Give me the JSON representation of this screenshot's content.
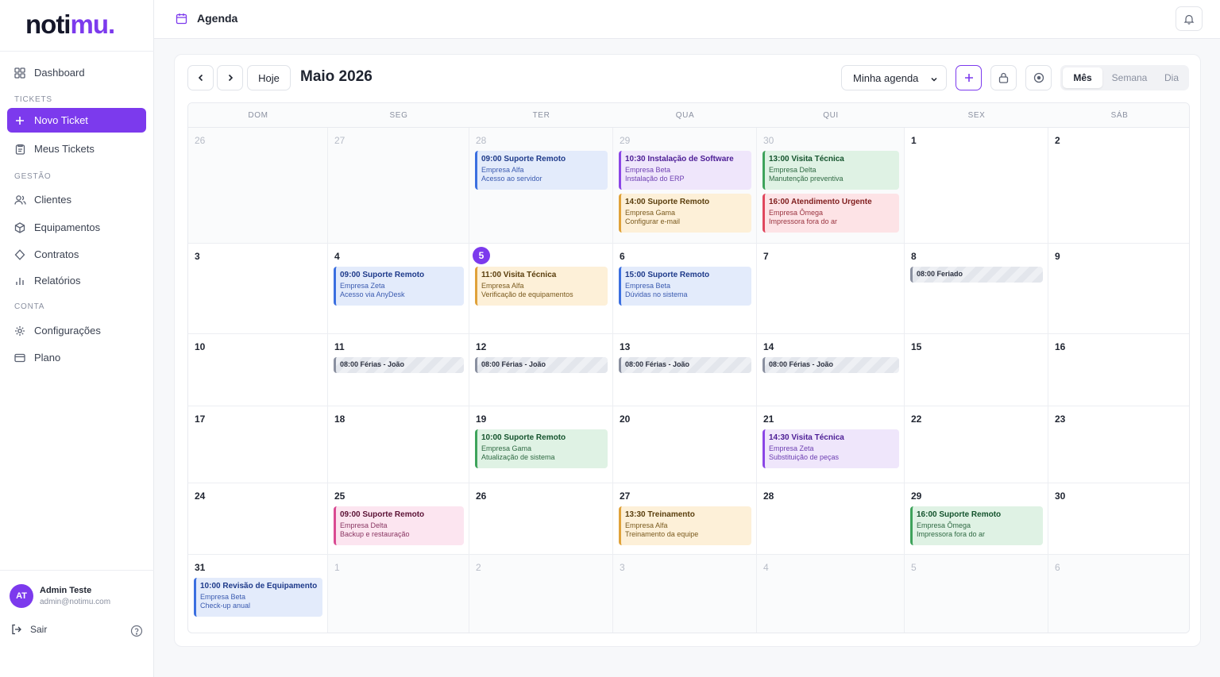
{
  "app": {
    "logo_main": "noti",
    "logo_accent": "mu",
    "logo_dot": "."
  },
  "sidebar": {
    "dashboard": "Dashboard",
    "section_tickets": "TICKETS",
    "new_ticket": "Novo Ticket",
    "my_tickets": "Meus Tickets",
    "section_management": "GESTÃO",
    "clients": "Clientes",
    "equipment": "Equipamentos",
    "contracts": "Contratos",
    "reports": "Relatórios",
    "section_account": "CONTA",
    "settings": "Configurações",
    "plan": "Plano",
    "user_initials": "AT",
    "user_name": "Admin Teste",
    "user_email": "admin@notimu.com",
    "logout": "Sair"
  },
  "header": {
    "title": "Agenda"
  },
  "toolbar": {
    "today": "Hoje",
    "month_title": "Maio 2026",
    "agenda_select": "Minha agenda",
    "view_month": "Mês",
    "view_week": "Semana",
    "view_day": "Dia",
    "active_view": "Mês"
  },
  "colors": {
    "accent": "#7c3aed"
  },
  "calendar": {
    "weekdays": [
      "DOM",
      "SEG",
      "TER",
      "QUA",
      "QUI",
      "SEX",
      "SÁB"
    ],
    "today": "5",
    "weeks": [
      [
        {
          "day": "26",
          "other": true,
          "events": []
        },
        {
          "day": "27",
          "other": true,
          "events": []
        },
        {
          "day": "28",
          "other": true,
          "events": [
            {
              "time": "09:00 Suporte Remoto",
              "company": "Empresa Alfa",
              "desc": "Acesso ao servidor",
              "color": "blue"
            }
          ]
        },
        {
          "day": "29",
          "other": true,
          "events": [
            {
              "time": "10:30 Instalação de Software",
              "company": "Empresa Beta",
              "desc": "Instalação do ERP",
              "color": "purple"
            },
            {
              "time": "14:00 Suporte Remoto",
              "company": "Empresa Gama",
              "desc": "Configurar e-mail",
              "color": "yellow"
            }
          ]
        },
        {
          "day": "30",
          "other": true,
          "events": [
            {
              "time": "13:00 Visita Técnica",
              "company": "Empresa Delta",
              "desc": "Manutenção preventiva",
              "color": "green"
            },
            {
              "time": "16:00 Atendimento Urgente",
              "company": "Empresa Ômega",
              "desc": "Impressora fora do ar",
              "color": "red"
            }
          ]
        },
        {
          "day": "1",
          "other": false,
          "events": []
        },
        {
          "day": "2",
          "other": false,
          "events": []
        }
      ],
      [
        {
          "day": "3",
          "other": false,
          "events": []
        },
        {
          "day": "4",
          "other": false,
          "events": [
            {
              "time": "09:00 Suporte Remoto",
              "company": "Empresa Zeta",
              "desc": "Acesso via AnyDesk",
              "color": "blue"
            }
          ]
        },
        {
          "day": "5",
          "other": false,
          "events": [
            {
              "time": "11:00 Visita Técnica",
              "company": "Empresa Alfa",
              "desc": "Verificação de equipamentos",
              "color": "yellow"
            }
          ]
        },
        {
          "day": "6",
          "other": false,
          "events": [
            {
              "time": "15:00 Suporte Remoto",
              "company": "Empresa Beta",
              "desc": "Dúvidas no sistema",
              "color": "blue"
            }
          ]
        },
        {
          "day": "7",
          "other": false,
          "events": []
        },
        {
          "day": "8",
          "other": false,
          "events": [
            {
              "time": "08:00 Feriado",
              "color": "holiday"
            }
          ]
        },
        {
          "day": "9",
          "other": false,
          "events": []
        }
      ],
      [
        {
          "day": "10",
          "other": false,
          "events": []
        },
        {
          "day": "11",
          "other": false,
          "events": [
            {
              "time": "08:00 Férias - João",
              "color": "holiday"
            }
          ]
        },
        {
          "day": "12",
          "other": false,
          "events": [
            {
              "time": "08:00 Férias - João",
              "color": "holiday"
            }
          ]
        },
        {
          "day": "13",
          "other": false,
          "events": [
            {
              "time": "08:00 Férias - João",
              "color": "holiday"
            }
          ]
        },
        {
          "day": "14",
          "other": false,
          "events": [
            {
              "time": "08:00 Férias - João",
              "color": "holiday"
            }
          ]
        },
        {
          "day": "15",
          "other": false,
          "events": []
        },
        {
          "day": "16",
          "other": false,
          "events": []
        }
      ],
      [
        {
          "day": "17",
          "other": false,
          "events": []
        },
        {
          "day": "18",
          "other": false,
          "events": []
        },
        {
          "day": "19",
          "other": false,
          "events": [
            {
              "time": "10:00 Suporte Remoto",
              "company": "Empresa Gama",
              "desc": "Atualização de sistema",
              "color": "green"
            }
          ]
        },
        {
          "day": "20",
          "other": false,
          "events": []
        },
        {
          "day": "21",
          "other": false,
          "events": [
            {
              "time": "14:30 Visita Técnica",
              "company": "Empresa Zeta",
              "desc": "Substituição de peças",
              "color": "purple"
            }
          ]
        },
        {
          "day": "22",
          "other": false,
          "events": []
        },
        {
          "day": "23",
          "other": false,
          "events": []
        }
      ],
      [
        {
          "day": "24",
          "other": false,
          "events": []
        },
        {
          "day": "25",
          "other": false,
          "events": [
            {
              "time": "09:00 Suporte Remoto",
              "company": "Empresa Delta",
              "desc": "Backup e restauração",
              "color": "pink"
            }
          ]
        },
        {
          "day": "26",
          "other": false,
          "events": []
        },
        {
          "day": "27",
          "other": false,
          "events": [
            {
              "time": "13:30 Treinamento",
              "company": "Empresa Alfa",
              "desc": "Treinamento da equipe",
              "color": "yellow"
            }
          ]
        },
        {
          "day": "28",
          "other": false,
          "events": []
        },
        {
          "day": "29",
          "other": false,
          "events": [
            {
              "time": "16:00 Suporte Remoto",
              "company": "Empresa Ômega",
              "desc": "Impressora fora do ar",
              "color": "green"
            }
          ]
        },
        {
          "day": "30",
          "other": false,
          "events": []
        }
      ],
      [
        {
          "day": "31",
          "other": false,
          "events": [
            {
              "time": "10:00 Revisão de Equipamento",
              "company": "Empresa Beta",
              "desc": "Check-up anual",
              "color": "blue"
            }
          ]
        },
        {
          "day": "1",
          "other": true,
          "events": []
        },
        {
          "day": "2",
          "other": true,
          "events": []
        },
        {
          "day": "3",
          "other": true,
          "events": []
        },
        {
          "day": "4",
          "other": true,
          "events": []
        },
        {
          "day": "5",
          "other": true,
          "events": []
        },
        {
          "day": "6",
          "other": true,
          "events": []
        }
      ]
    ]
  }
}
